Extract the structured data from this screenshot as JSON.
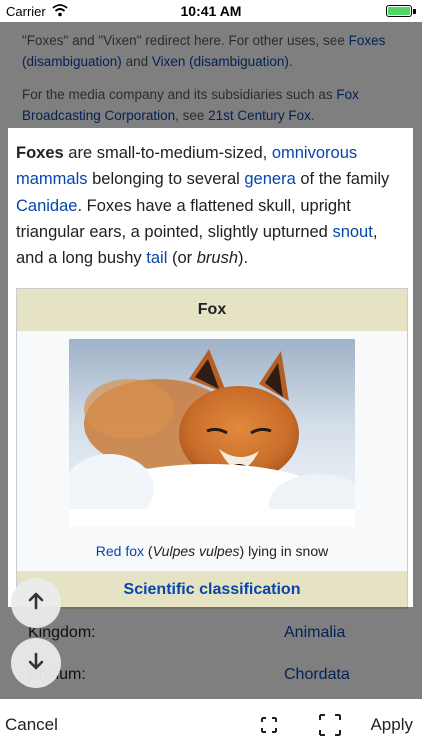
{
  "status_bar": {
    "carrier": "Carrier",
    "time": "10:41 AM"
  },
  "article_top": {
    "note1_prefix": "\"Foxes\" and \"Vixen\" redirect here. For other uses, see ",
    "note1_link1": "Foxes (disambiguation)",
    "note1_mid": " and ",
    "note1_link2": "Vixen (disambiguation)",
    "note1_suffix": ".",
    "note2_prefix": "For the media company and its subsidiaries such as ",
    "note2_link1": "Fox Broadcasting Corporation",
    "note2_mid": ", see ",
    "note2_link2": "21st Century Fox",
    "note2_suffix": "."
  },
  "lead": {
    "bold": "Foxes",
    "t1": " are small-to-medium-sized, ",
    "l1": "omnivorous mammals",
    "t2": " belonging to several ",
    "l2": "genera",
    "t3": " of the family ",
    "l3": "Canidae",
    "t4": ". Foxes have a flattened skull, upright triangular ears, a pointed, slightly upturned ",
    "l4": "snout",
    "t5": ", and a long bushy ",
    "l5": "tail",
    "t6": " (or ",
    "italic": "brush",
    "t7": ")."
  },
  "infobox": {
    "title": "Fox",
    "caption_link": "Red fox",
    "caption_pre": " (",
    "caption_italic": "Vulpes vulpes",
    "caption_post": ") lying in snow",
    "section": "Scientific classification"
  },
  "classification": [
    {
      "key": "Kingdom:",
      "value": "Animalia"
    },
    {
      "key": "Phylum:",
      "value": "Chordata"
    }
  ],
  "toolbar": {
    "cancel": "Cancel",
    "apply": "Apply"
  },
  "icons": {
    "rotate_up": "arrow-up-icon",
    "rotate_down": "arrow-down-icon",
    "aspect_left": "crop-aspect-icon",
    "aspect_right": "crop-fit-icon"
  },
  "colors": {
    "link": "#0645ad",
    "infobox_header": "#e6e3c4",
    "battery": "#4cd964"
  }
}
